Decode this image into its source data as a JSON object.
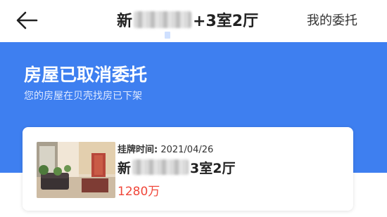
{
  "header": {
    "back_icon": "back-arrow-icon",
    "title_prefix": "新",
    "title_suffix": "+3室2厅",
    "right_link": "我的委托"
  },
  "banner": {
    "title": "房屋已取消委托",
    "subtitle": "您的房屋在贝壳找房已下架",
    "background_color": "#3e7ff0"
  },
  "listing": {
    "time_label": "挂牌时间:",
    "time_value": "2021/04/26",
    "title_prefix": "新",
    "title_suffix": "3室2厅",
    "price": "1280万",
    "price_color": "#f0473a"
  }
}
